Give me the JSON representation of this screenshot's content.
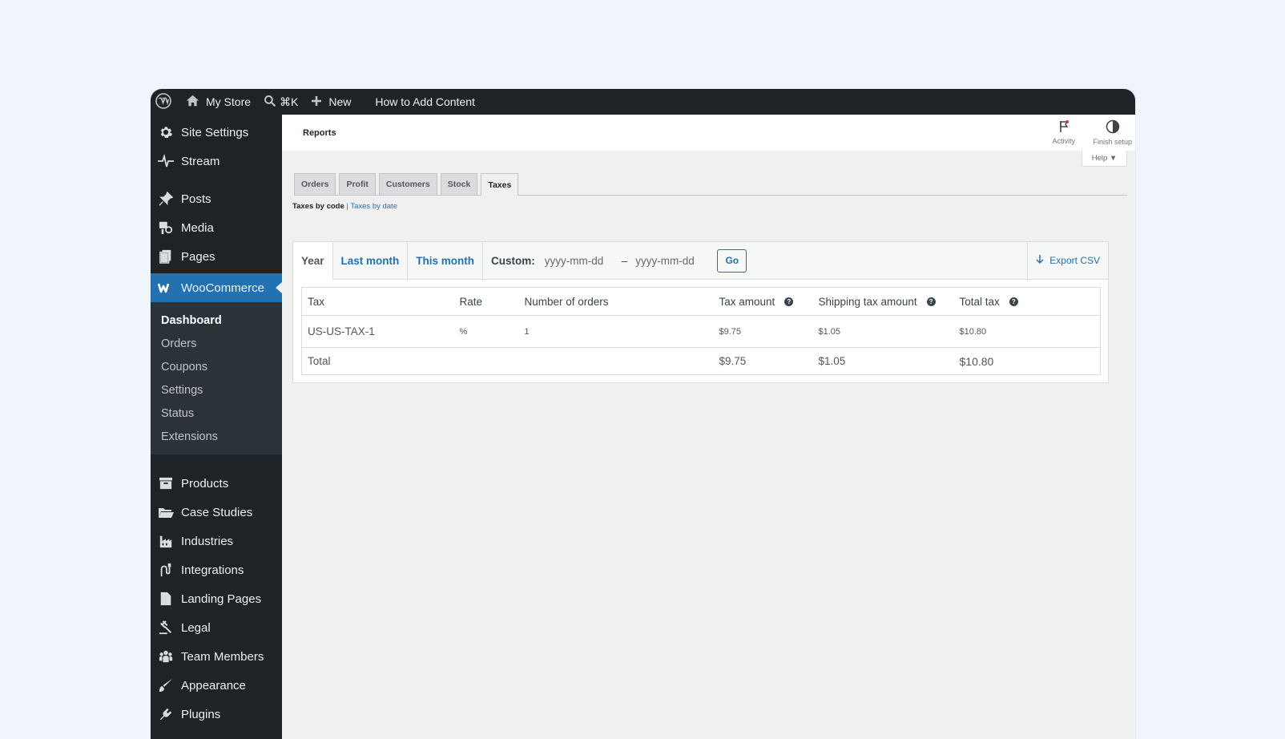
{
  "adminbar": {
    "site_name": "My Store",
    "search_shortcut": "⌘K",
    "new_label": "New",
    "how_to_label": "How to Add Content"
  },
  "sidebar": {
    "top_items": [
      {
        "label": "Site Settings",
        "icon": "gear-icon"
      },
      {
        "label": "Stream",
        "icon": "pulse-icon"
      }
    ],
    "items": [
      {
        "label": "Posts",
        "icon": "pin-icon"
      },
      {
        "label": "Media",
        "icon": "media-icon"
      },
      {
        "label": "Pages",
        "icon": "pages-icon"
      }
    ],
    "woocommerce": {
      "label": "WooCommerce",
      "submenu": [
        "Dashboard",
        "Orders",
        "Coupons",
        "Settings",
        "Status",
        "Extensions"
      ]
    },
    "bottom_items": [
      {
        "label": "Products",
        "icon": "archive-icon"
      },
      {
        "label": "Case Studies",
        "icon": "folder-icon"
      },
      {
        "label": "Industries",
        "icon": "factory-icon"
      },
      {
        "label": "Integrations",
        "icon": "plug-icon"
      },
      {
        "label": "Landing Pages",
        "icon": "page-icon"
      },
      {
        "label": "Legal",
        "icon": "gavel-icon"
      },
      {
        "label": "Team Members",
        "icon": "groups-icon"
      },
      {
        "label": "Appearance",
        "icon": "brush-icon"
      },
      {
        "label": "Plugins",
        "icon": "plugin-icon"
      }
    ]
  },
  "header": {
    "title": "Reports",
    "activity_label": "Activity",
    "finish_setup_label": "Finish setup",
    "help_label": "Help ▼"
  },
  "tabs": [
    "Orders",
    "Profit",
    "Customers",
    "Stock",
    "Taxes"
  ],
  "active_tab": "Taxes",
  "subnav": {
    "current": "Taxes by code",
    "separator": "|",
    "link": "Taxes by date"
  },
  "ranges": {
    "year": "Year",
    "last_month": "Last month",
    "this_month": "This month",
    "custom_label": "Custom:",
    "date_placeholder": "yyyy-mm-dd",
    "dash": "–",
    "go": "Go",
    "export": "Export CSV"
  },
  "table": {
    "headers": [
      "Tax",
      "Rate",
      "Number of orders",
      "Tax amount",
      "Shipping tax amount",
      "Total tax"
    ],
    "help_glyph": "?",
    "rows": [
      {
        "tax": "US-US-TAX-1",
        "rate": "%",
        "orders": "1",
        "tax_amount": "$9.75",
        "shipping_tax": "$1.05",
        "total_tax": "$10.80"
      }
    ],
    "footer": {
      "label": "Total",
      "tax_amount": "$9.75",
      "shipping_tax": "$1.05",
      "total_tax": "$10.80"
    }
  }
}
